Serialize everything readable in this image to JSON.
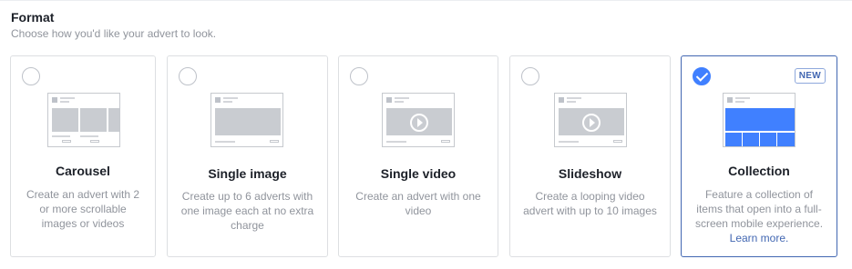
{
  "header": {
    "title": "Format",
    "subtitle": "Choose how you'd like your advert to look."
  },
  "formats": [
    {
      "name": "Carousel",
      "description": "Create an advert with 2 or more scrollable images or videos",
      "selected": false
    },
    {
      "name": "Single image",
      "description": "Create up to 6 adverts with one image each at no extra charge",
      "selected": false
    },
    {
      "name": "Single video",
      "description": "Create an advert with one video",
      "selected": false
    },
    {
      "name": "Slideshow",
      "description": "Create a looping video advert with up to 10 images",
      "selected": false
    },
    {
      "name": "Collection",
      "description": "Feature a collection of items that open into a full-screen mobile experience.",
      "link": "Learn more.",
      "badge": "NEW",
      "selected": true
    }
  ],
  "colors": {
    "accent": "#4267b2",
    "selected_fill": "#4080ff",
    "media_placeholder": "#c9ccd1"
  }
}
